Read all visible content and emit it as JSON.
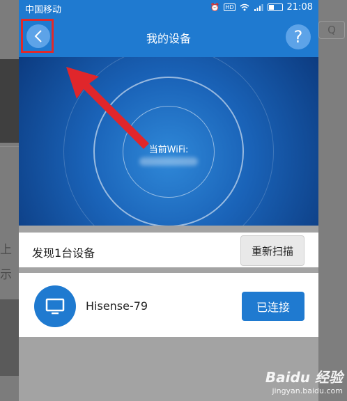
{
  "status_bar": {
    "carrier": "中国移动",
    "time": "21:08",
    "hd_badge": "HD"
  },
  "nav": {
    "title": "我的设备",
    "help_label": "?"
  },
  "hero": {
    "wifi_label": "当前WiFi:"
  },
  "scan": {
    "found_text": "发现1台设备",
    "rescan_label": "重新扫描"
  },
  "device": {
    "name": "Hisense-79",
    "status_label": "已连接"
  },
  "background_page": {
    "fragment_1": "上",
    "fragment_2": "示"
  },
  "watermark": {
    "brand": "Baidu 经验",
    "site": "jingyan.baidu.com"
  },
  "colors": {
    "primary": "#1f7ad0",
    "highlight": "#e02a2a"
  },
  "icons": [
    "back-chevron-icon",
    "help-icon",
    "monitor-icon",
    "alarm-icon",
    "wifi-icon",
    "signal-icon",
    "battery-icon",
    "red-arrow"
  ]
}
